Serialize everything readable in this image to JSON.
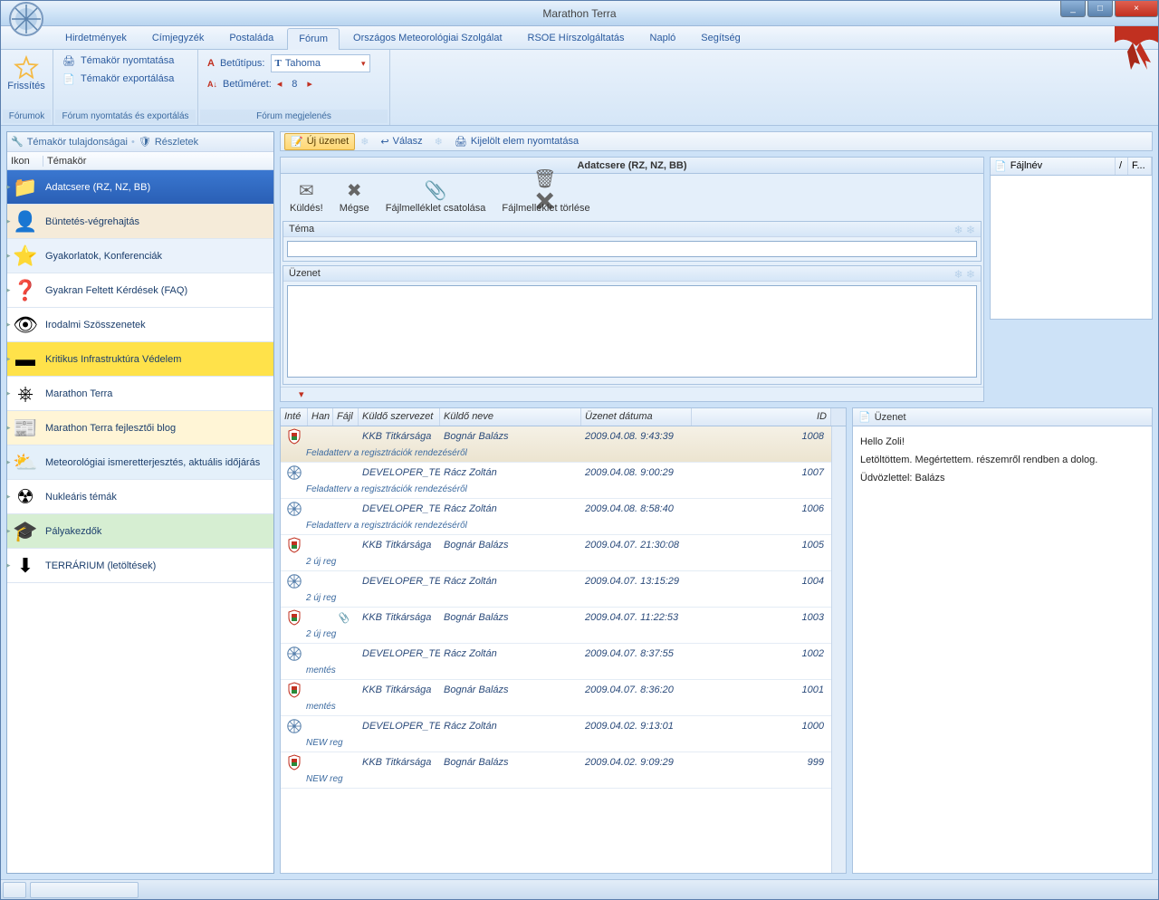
{
  "app": {
    "title": "Marathon Terra"
  },
  "win": {
    "min": "_",
    "max": "□",
    "close": "×"
  },
  "tabs": [
    "Hirdetmények",
    "Címjegyzék",
    "Postaláda",
    "Fórum",
    "Országos Meteorológiai Szolgálat",
    "RSOE Hírszolgáltatás",
    "Napló",
    "Segítség"
  ],
  "active_tab": 3,
  "ribbon": {
    "group1": {
      "label": "Fórumok",
      "refresh": "Frissítés"
    },
    "group2": {
      "label": "Fórum nyomtatás és exportálás",
      "print": "Témakör nyomtatása",
      "export": "Témakör exportálása"
    },
    "group3": {
      "label": "Fórum megjelenés",
      "font_label": "Betűtípus:",
      "font_value": "Tahoma",
      "size_label": "Betűméret:",
      "size_value": "8"
    }
  },
  "left": {
    "props": "Témakör tulajdonságai",
    "details": "Részletek",
    "col_icon": "Ikon",
    "col_topic": "Témakör",
    "topics": [
      {
        "t": "Adatcsere (RZ, NZ, BB)",
        "c": "sel",
        "i": "folder"
      },
      {
        "t": "Büntetés-végrehajtás",
        "c": "r-beige",
        "i": "person"
      },
      {
        "t": "Gyakorlatok, Konferenciák",
        "c": "r-blue",
        "i": "star"
      },
      {
        "t": "Gyakran Feltett Kérdések (FAQ)",
        "c": "",
        "i": "question"
      },
      {
        "t": "Irodalmi Szösszenetek",
        "c": "",
        "i": "eye"
      },
      {
        "t": "Kritikus Infrastruktúra Védelem",
        "c": "r-yellow",
        "i": "kiv"
      },
      {
        "t": "Marathon Terra",
        "c": "",
        "i": "wheel"
      },
      {
        "t": "Marathon Terra fejlesztői blog",
        "c": "r-ltyellow",
        "i": "blog"
      },
      {
        "t": "Meteorológiai ismeretterjesztés, aktuális időjárás",
        "c": "r-ltblue",
        "i": "weather"
      },
      {
        "t": "Nukleáris témák",
        "c": "",
        "i": "nuke"
      },
      {
        "t": "Pályakezdők",
        "c": "r-green",
        "i": "grad"
      },
      {
        "t": "TERRÁRIUM (letöltések)",
        "c": "",
        "i": "download"
      }
    ]
  },
  "toolbar": {
    "new": "Új üzenet",
    "reply": "Válasz",
    "print": "Kijelölt elem nyomtatása"
  },
  "compose": {
    "head": "Adatcsere (RZ, NZ, BB)",
    "send": "Küldés!",
    "cancel": "Mégse",
    "attach": "Fájlmelléklet csatolása",
    "del": "Fájlmelléklet törlése",
    "subject": "Téma",
    "message": "Üzenet"
  },
  "attach": {
    "file": "Fájlnév",
    "f2": "F..."
  },
  "msgcols": {
    "c1": "Inté",
    "c2": "Han",
    "c3": "Fájl",
    "c4": "Küldő szervezet",
    "c5": "Küldő neve",
    "c6": "Üzenet dátuma",
    "c7": "ID"
  },
  "messages": [
    {
      "org": "KKB Titkársága",
      "name": "Bognár Balázs",
      "date": "2009.04.08. 9:43:39",
      "id": "1008",
      "sub": "Feladatterv a regisztrációk rendezéséről",
      "ic": "shield",
      "sel": true
    },
    {
      "org": "DEVELOPER_TEA",
      "name": "Rácz Zoltán",
      "date": "2009.04.08. 9:00:29",
      "id": "1007",
      "sub": "Feladatterv a regisztrációk rendezéséről",
      "ic": "wheel"
    },
    {
      "org": "DEVELOPER_TEA",
      "name": "Rácz Zoltán",
      "date": "2009.04.08. 8:58:40",
      "id": "1006",
      "sub": "Feladatterv a regisztrációk rendezéséről",
      "ic": "wheel"
    },
    {
      "org": "KKB Titkársága",
      "name": "Bognár Balázs",
      "date": "2009.04.07. 21:30:08",
      "id": "1005",
      "sub": "2 új reg",
      "ic": "shield"
    },
    {
      "org": "DEVELOPER_TEA",
      "name": "Rácz Zoltán",
      "date": "2009.04.07. 13:15:29",
      "id": "1004",
      "sub": "2 új reg",
      "ic": "wheel"
    },
    {
      "org": "KKB Titkársága",
      "name": "Bognár Balázs",
      "date": "2009.04.07. 11:22:53",
      "id": "1003",
      "sub": "2 új reg",
      "ic": "shield",
      "file": true
    },
    {
      "org": "DEVELOPER_TEA",
      "name": "Rácz Zoltán",
      "date": "2009.04.07. 8:37:55",
      "id": "1002",
      "sub": "mentés",
      "ic": "wheel"
    },
    {
      "org": "KKB Titkársága",
      "name": "Bognár Balázs",
      "date": "2009.04.07. 8:36:20",
      "id": "1001",
      "sub": "mentés",
      "ic": "shield"
    },
    {
      "org": "DEVELOPER_TEA",
      "name": "Rácz Zoltán",
      "date": "2009.04.02. 9:13:01",
      "id": "1000",
      "sub": "NEW reg",
      "ic": "wheel"
    },
    {
      "org": "KKB Titkársága",
      "name": "Bognár Balázs",
      "date": "2009.04.02. 9:09:29",
      "id": "999",
      "sub": "NEW reg",
      "ic": "shield"
    }
  ],
  "preview": {
    "head": "Üzenet",
    "l1": "Hello Zoli!",
    "l2": "Letöltöttem. Megértettem. részemről rendben a dolog.",
    "l3": "Üdvözlettel: Balázs"
  }
}
